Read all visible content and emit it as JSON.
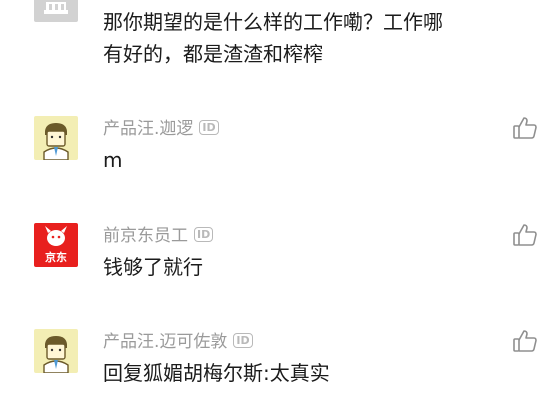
{
  "comments": [
    {
      "avatar": "building-avatar-icon",
      "text_lines": [
        "那你期望的是什么样的工作嘞？工作哪",
        "有好的，都是渣渣和榨榨"
      ]
    },
    {
      "username": "产品汪.迦逻",
      "id_badge": "ID",
      "avatar": "product-dog-avatar-icon",
      "text": "m",
      "like_icon": "thumbs-up-icon"
    },
    {
      "username": "前京东员工",
      "id_badge": "ID",
      "avatar": "jd-logo-avatar-icon",
      "avatar_text": "京东",
      "text": "钱够了就行",
      "like_icon": "thumbs-up-icon"
    },
    {
      "username": "产品汪.迈可佐敦",
      "id_badge": "ID",
      "avatar": "product-dog-avatar-icon",
      "text": "回复狐媚胡梅尔斯:太真实",
      "like_icon": "thumbs-up-icon"
    }
  ],
  "colors": {
    "username": "#9a9a9a",
    "content": "#1b1b1b",
    "jd_red": "#e8201e",
    "pm_avatar_bg": "#f3eeb4"
  }
}
